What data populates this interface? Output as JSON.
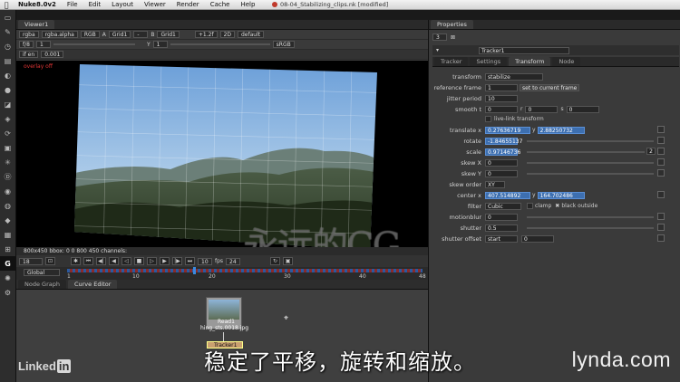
{
  "menubar": {
    "app": "Nuke8.0v2",
    "items": [
      "File",
      "Edit",
      "Layout",
      "Viewer",
      "Render",
      "Cache",
      "Help"
    ],
    "window_title": "08-04_Stabilizing_clips.nk [modified]"
  },
  "viewer": {
    "tab": "Viewer1",
    "channel": "rgba",
    "alpha": "rgba.alpha",
    "space": "RGB",
    "input_a_label": "A",
    "input_a": "Grid1",
    "input_b_label": "B",
    "input_b": "Grid1",
    "exposure": "+1.2f",
    "view": "2D",
    "lut": "default",
    "fstop": "f/8",
    "gain": "1",
    "y_label": "Y",
    "y_value": "1",
    "input_proc": "if en",
    "gamma": "0.001",
    "display_lut": "sRGB",
    "overlay": "overlay off",
    "bbox_text": "800x450 bbox: 0 0 800 450 channels:"
  },
  "transport": {
    "frame": "18",
    "increment": "10",
    "fps_label": "fps",
    "fps": "24"
  },
  "timeline": {
    "scope": "Global",
    "ticks": [
      "1",
      "10",
      "20",
      "30",
      "40",
      "48"
    ]
  },
  "nodegraph": {
    "tabs": [
      "Node Graph",
      "Curve Editor"
    ],
    "read_node_label": "Read1",
    "read_node_file": "hing_sts.0018.jpg",
    "tracker_node_label": "Tracker1"
  },
  "properties": {
    "title": "Properties",
    "count": "3",
    "node_name": "Tracker1",
    "tabs": [
      "Tracker",
      "Settings",
      "Transform",
      "Node"
    ],
    "transform": "stabilize",
    "reference_frame": "1",
    "set_to_current_frame": "set to current frame",
    "jitter_period": "10",
    "smooth_t": "0",
    "smooth_r": "0",
    "smooth_s": "0",
    "live_link": "live-link transform",
    "translate_x": "0.27636719",
    "translate_y": "2.88250732",
    "rotate": "-1.84655137",
    "scale": "0.97146736",
    "scale_count": "2",
    "skew_x": "0",
    "skew_y": "0",
    "skew_order": "XY",
    "center_x": "407.514892",
    "center_y": "164.702486",
    "filter": "Cubic",
    "clamp": "clamp",
    "black_outside": "black outside",
    "motionblur": "0",
    "shutter": "0.5",
    "shutter_offset": "start",
    "shutter_offset_value": "0",
    "labels": {
      "transform": "transform",
      "reference_frame": "reference frame",
      "jitter_period": "jitter period",
      "smooth": "smooth",
      "t": "t",
      "r": "r",
      "s": "s",
      "translate": "translate",
      "x": "x",
      "y": "y",
      "rotate": "rotate",
      "scale": "scale",
      "skew_x": "skew X",
      "skew_y": "skew Y",
      "skew_order": "skew order",
      "center": "center",
      "filter": "filter",
      "motionblur": "motionblur",
      "shutter": "shutter",
      "shutter_offset": "shutter offset"
    }
  },
  "subtitle": "稳定了平移，旋转和缩放。",
  "watermark": "永远的CG",
  "branding": {
    "linkedin": "Linked",
    "linkedin_in": "in",
    "lynda": "lynda.com"
  }
}
